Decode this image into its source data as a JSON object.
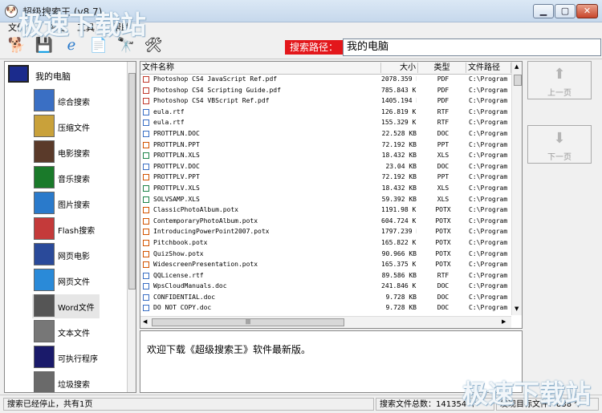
{
  "window": {
    "title": "超级搜索王 (v8.7)"
  },
  "menu": [
    "文件",
    "查看",
    "工具",
    "帮助"
  ],
  "toolbar": {
    "buttons": [
      {
        "icon": "dog-mascot-icon"
      },
      {
        "icon": "save-icon"
      },
      {
        "icon": "internet-explorer-icon"
      },
      {
        "icon": "document-icon"
      },
      {
        "icon": "binoculars-icon"
      },
      {
        "icon": "tools-icon"
      }
    ],
    "search_path_label": "搜索路径：",
    "search_path_value": "我的电脑"
  },
  "nav": {
    "root": "我的电脑",
    "items": [
      {
        "label": "综合搜索",
        "icon": "comprehensive-search-icon",
        "color": "#3a6fc4"
      },
      {
        "label": "压缩文件",
        "icon": "archive-icon",
        "color": "#c9a13a"
      },
      {
        "label": "电影搜索",
        "icon": "film-icon",
        "color": "#5a3a2a"
      },
      {
        "label": "音乐搜索",
        "icon": "music-icon",
        "color": "#1a7a2a"
      },
      {
        "label": "图片搜索",
        "icon": "picture-icon",
        "color": "#2a7acb"
      },
      {
        "label": "Flash搜索",
        "icon": "flash-icon",
        "color": "#c43a3a"
      },
      {
        "label": "网页电影",
        "icon": "web-movie-icon",
        "color": "#2a4a9a"
      },
      {
        "label": "网页文件",
        "icon": "web-file-icon",
        "color": "#2a8ad8"
      },
      {
        "label": "Word文件",
        "icon": "word-icon",
        "color": "#555555"
      },
      {
        "label": "文本文件",
        "icon": "text-file-icon",
        "color": "#777777"
      },
      {
        "label": "可执行程序",
        "icon": "executable-icon",
        "color": "#1a1a6a"
      },
      {
        "label": "垃圾搜索",
        "icon": "trash-icon",
        "color": "#6a6a6a"
      }
    ],
    "selected_index": 8
  },
  "table": {
    "columns": [
      "文件名称",
      "大小",
      "类型",
      "文件路径"
    ],
    "rows": [
      [
        "Photoshop CS4 JavaScript Ref.pdf",
        "2078.359 KB",
        "PDF",
        "C:\\Program"
      ],
      [
        "Photoshop CS4 Scripting Guide.pdf",
        "785.843 KB",
        "PDF",
        "C:\\Program"
      ],
      [
        "Photoshop CS4 VBScript Ref.pdf",
        "1405.194 KB",
        "PDF",
        "C:\\Program"
      ],
      [
        "eula.rtf",
        "126.819 KB",
        "RTF",
        "C:\\Program"
      ],
      [
        "eula.rtf",
        "155.329 KB",
        "RTF",
        "C:\\Program"
      ],
      [
        "PROTTPLN.DOC",
        "22.528 KB",
        "DOC",
        "C:\\Program"
      ],
      [
        "PROTTPLN.PPT",
        "72.192 KB",
        "PPT",
        "C:\\Program"
      ],
      [
        "PROTTPLN.XLS",
        "18.432 KB",
        "XLS",
        "C:\\Program"
      ],
      [
        "PROTTPLV.DOC",
        "23.04 KB",
        "DOC",
        "C:\\Program"
      ],
      [
        "PROTTPLV.PPT",
        "72.192 KB",
        "PPT",
        "C:\\Program"
      ],
      [
        "PROTTPLV.XLS",
        "18.432 KB",
        "XLS",
        "C:\\Program"
      ],
      [
        "SOLVSAMP.XLS",
        "59.392 KB",
        "XLS",
        "C:\\Program"
      ],
      [
        "ClassicPhotoAlbum.potx",
        "1191.98 KB",
        "POTX",
        "C:\\Program"
      ],
      [
        "ContemporaryPhotoAlbum.potx",
        "604.724 KB",
        "POTX",
        "C:\\Program"
      ],
      [
        "IntroducingPowerPoint2007.potx",
        "1797.239 KB",
        "POTX",
        "C:\\Program"
      ],
      [
        "Pitchbook.potx",
        "165.822 KB",
        "POTX",
        "C:\\Program"
      ],
      [
        "QuizShow.potx",
        "90.966 KB",
        "POTX",
        "C:\\Program"
      ],
      [
        "WidescreenPresentation.potx",
        "165.375 KB",
        "POTX",
        "C:\\Program"
      ],
      [
        "QQLicense.rtf",
        "89.586 KB",
        "RTF",
        "C:\\Program"
      ],
      [
        "WpsCloudManuals.doc",
        "241.846 KB",
        "DOC",
        "C:\\Program"
      ],
      [
        "CONFIDENTIAL.doc",
        "9.728 KB",
        "DOC",
        "C:\\Program"
      ],
      [
        "DO NOT COPY.doc",
        "9.728 KB",
        "DOC",
        "C:\\Program"
      ]
    ],
    "type_colors": {
      "PDF": "#c0392b",
      "RTF": "#3a6fc4",
      "DOC": "#3a6fc4",
      "PPT": "#d35400",
      "XLS": "#1e8449",
      "POTX": "#d35400"
    }
  },
  "paging": {
    "prev_label": "上一页",
    "next_label": "下一页"
  },
  "message": "欢迎下载《超级搜索王》软件最新版。",
  "status": {
    "left": "搜索已经停止，共有1页",
    "total": "搜索文件总数：141354 个",
    "found": "发现目标文件：838 个"
  },
  "watermark": "极速下载站"
}
